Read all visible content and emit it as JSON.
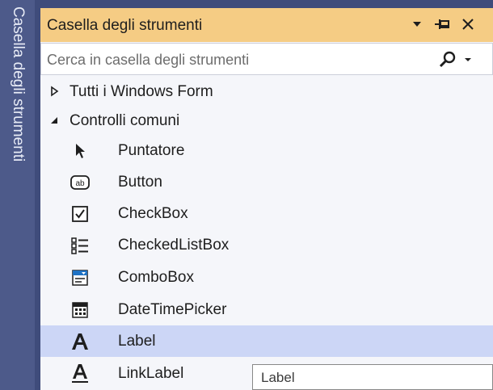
{
  "side_tab": {
    "label": "Casella degli strumenti"
  },
  "panel": {
    "title": "Casella degli strumenti",
    "buttons": [
      {
        "name": "dropdown",
        "icon": "chevron-down-icon"
      },
      {
        "name": "pin",
        "icon": "pin-icon"
      },
      {
        "name": "close",
        "icon": "close-icon"
      }
    ]
  },
  "search": {
    "placeholder": "Cerca in casella degli strumenti",
    "value": "",
    "icon": "search-icon"
  },
  "groups": [
    {
      "label": "Tutti i Windows Form",
      "expanded": false
    },
    {
      "label": "Controlli comuni",
      "expanded": true
    }
  ],
  "items": [
    {
      "label": "Puntatore",
      "icon": "pointer-icon",
      "selected": false
    },
    {
      "label": "Button",
      "icon": "button-icon",
      "selected": false
    },
    {
      "label": "CheckBox",
      "icon": "checkbox-icon",
      "selected": false
    },
    {
      "label": "CheckedListBox",
      "icon": "checked-list-box-icon",
      "selected": false
    },
    {
      "label": "ComboBox",
      "icon": "combobox-icon",
      "selected": false
    },
    {
      "label": "DateTimePicker",
      "icon": "calendar-icon",
      "selected": false
    },
    {
      "label": "Label",
      "icon": "label-icon",
      "selected": true
    },
    {
      "label": "LinkLabel",
      "icon": "link-label-icon",
      "selected": false
    }
  ],
  "tooltip": {
    "text": "Label"
  },
  "colors": {
    "title_bar": "#f5cc84",
    "selected_row": "#ccd6f6",
    "background": "#3f4c7b",
    "icon_blue": "#1f72c4"
  }
}
